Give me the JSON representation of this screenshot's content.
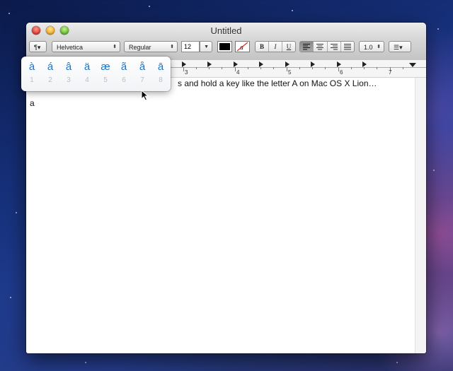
{
  "window": {
    "title": "Untitled"
  },
  "toolbar": {
    "paragraph_label": "¶▾",
    "font_family": "Helvetica",
    "font_style": "Regular",
    "font_size": "12",
    "bold": "B",
    "italic": "I",
    "underline": "U",
    "line_spacing": "1.0",
    "list_label": "☰▾",
    "text_color_hex": "#000000"
  },
  "ruler": {
    "numbers": [
      "3",
      "4",
      "5",
      "6",
      "7"
    ]
  },
  "document": {
    "line1": "s and hold a key like the letter A on Mac OS X Lion…",
    "line2": "a"
  },
  "accent_popup": {
    "options": [
      {
        "char": "à",
        "key": "1"
      },
      {
        "char": "á",
        "key": "2"
      },
      {
        "char": "â",
        "key": "3"
      },
      {
        "char": "ä",
        "key": "4"
      },
      {
        "char": "æ",
        "key": "5"
      },
      {
        "char": "ã",
        "key": "6"
      },
      {
        "char": "å",
        "key": "7"
      },
      {
        "char": "ā",
        "key": "8"
      }
    ]
  }
}
